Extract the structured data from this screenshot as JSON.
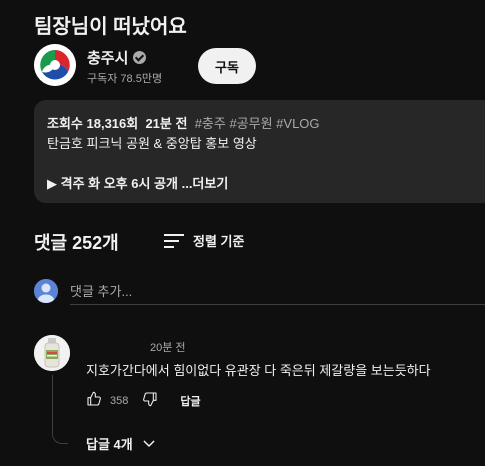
{
  "video": {
    "title": "팀장님이 떠났어요"
  },
  "channel": {
    "name": "충주시",
    "subscribers": "구독자 78.5만명",
    "subscribe_label": "구독",
    "verified_icon": "verified-check-icon"
  },
  "description": {
    "views": "조회수 18,316회",
    "age": "21분 전",
    "tags": "#충주 #공무원 #VLOG",
    "text": "탄금호 피크닉 공원 & 중앙탑 홍보 영상",
    "preview": "▶ 격주 화 오후 6시 공개",
    "more_label": "...더보기"
  },
  "comments": {
    "count_label": "댓글 252개",
    "sort_label": "정렬 기준",
    "add_placeholder": "댓글 추가...",
    "items": [
      {
        "time": "20분 전",
        "text": "지호가간다에서 힘이없다 유관장 다 죽은뒤 제갈량을 보는듯하다",
        "likes": "358",
        "reply_label": "답글",
        "replies_label": "답글 4개"
      }
    ]
  },
  "colors": {
    "background": "#0f0f0f",
    "surface": "#272727",
    "text_primary": "#f1f1f1",
    "text_secondary": "#aaaaaa",
    "subscribe_bg": "#f1f1f1"
  }
}
